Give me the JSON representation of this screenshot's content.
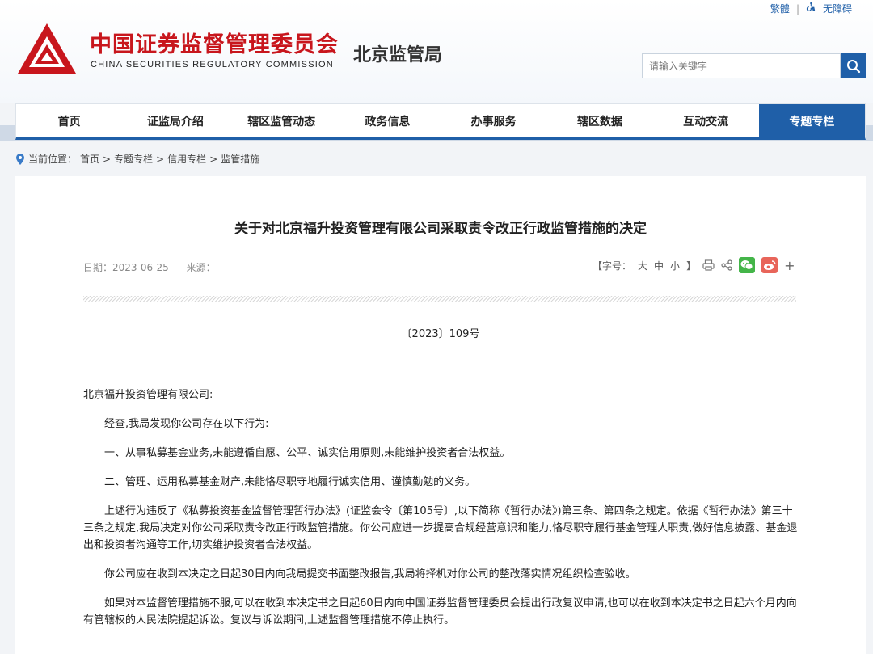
{
  "header": {
    "links": {
      "traditional": "繁體",
      "accessibility": "无障碍"
    },
    "logo_cn": "中国证券监督管理委员会",
    "logo_en": "CHINA SECURITIES REGULATORY COMMISSION",
    "bureau": "北京监管局",
    "search": {
      "placeholder": "请输入关键字"
    },
    "colors": {
      "brand_red": "#c8161d",
      "brand_blue": "#1f5fa8"
    }
  },
  "nav": {
    "items": [
      "首页",
      "证监局介绍",
      "辖区监管动态",
      "政务信息",
      "办事服务",
      "辖区数据",
      "互动交流",
      "专题专栏"
    ],
    "active": "专题专栏"
  },
  "breadcrumb": {
    "prefix": "当前位置：",
    "items": [
      "首页",
      "专题专栏",
      "信用专栏",
      "监管措施"
    ],
    "separator": ">"
  },
  "article": {
    "title": "关于对北京福升投资管理有限公司采取责令改正行政监管措施的决定",
    "date": "日期：2023-06-25",
    "source": "来源：",
    "font_size_label": "【字号：",
    "font_sizes": [
      "大",
      "中",
      "小"
    ],
    "font_size_close": "】",
    "doc_number": "〔2023〕109号",
    "paragraphs": [
      "北京福升投资管理有限公司:",
      "经查,我局发现你公司存在以下行为:",
      "一、从事私募基金业务,未能遵循自愿、公平、诚实信用原则,未能维护投资者合法权益。",
      "二、管理、运用私募基金财产,未能恪尽职守地履行诚实信用、谨慎勤勉的义务。",
      "上述行为违反了《私募投资基金监督管理暂行办法》(证监会令〔第105号〕,以下简称《暂行办法》)第三条、第四条之规定。依据《暂行办法》第三十三条之规定,我局决定对你公司采取责令改正行政监管措施。你公司应进一步提高合规经营意识和能力,恪尽职守履行基金管理人职责,做好信息披露、基金退出和投资者沟通等工作,切实维护投资者合法权益。",
      "你公司应在收到本决定之日起30日内向我局提交书面整改报告,我局将择机对你公司的整改落实情况组织检查验收。",
      "如果对本监督管理措施不服,可以在收到本决定书之日起60日内向中国证券监督管理委员会提出行政复议申请,也可以在收到本决定书之日起六个月内向有管辖权的人民法院提起诉讼。复议与诉讼期间,上述监督管理措施不停止执行。"
    ]
  },
  "icons": [
    "accessibility-icon",
    "logo-emblem-icon",
    "search-icon",
    "location-icon",
    "print-icon",
    "share-icon",
    "wechat-icon",
    "weibo-icon",
    "plus-icon"
  ]
}
